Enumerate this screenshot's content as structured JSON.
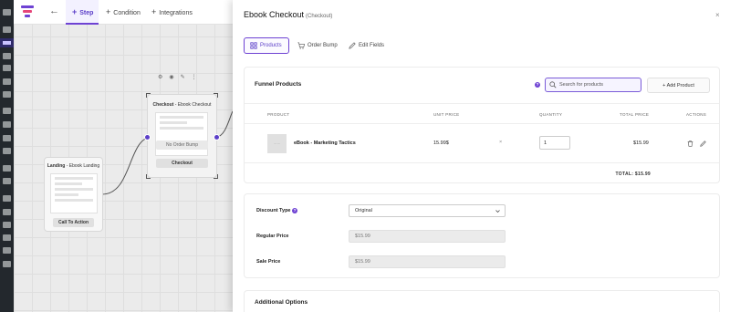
{
  "app": {
    "back_arrow": "←",
    "tabs": [
      {
        "label": "Step",
        "icon": "+"
      },
      {
        "label": "Condition",
        "icon": "+"
      },
      {
        "label": "Integrations",
        "icon": "+"
      }
    ],
    "brand_colors": [
      "#6e42d3",
      "#e6467a",
      "#2f2b6a"
    ]
  },
  "canvas": {
    "landing_node": {
      "title_bold": "Landing",
      "title_rest": " - Ebook Landing",
      "button": "Call To Action"
    },
    "checkout_node": {
      "title_bold": "Checkout",
      "title_rest": " - Ebook Checkout",
      "bump_label": "No Order Bump",
      "button": "Checkout"
    }
  },
  "panel": {
    "title": "Ebook Checkout",
    "subtitle": "(Checkout)",
    "close": "×",
    "tabs": [
      {
        "label": "Products",
        "icon": "grid-icon",
        "active": true
      },
      {
        "label": "Order Bump",
        "icon": "cart-icon",
        "active": false
      },
      {
        "label": "Edit Fields",
        "icon": "pencil-icon",
        "active": false
      }
    ]
  },
  "products": {
    "title": "Funnel Products",
    "help": "?",
    "search_placeholder": "Search for products",
    "add_button": "+ Add Product",
    "columns": [
      "PRODUCT",
      "UNIT PRICE",
      "QUANTITY",
      "TOTAL PRICE",
      "ACTIONS"
    ],
    "rows": [
      {
        "image_text": "— —",
        "name": "eBook - Marketing Tactics",
        "unit_price": "15.99$",
        "multiply": "×",
        "quantity": "1",
        "total_price": "$15.99"
      }
    ],
    "total_label": "TOTAL: $15.99"
  },
  "pricing": {
    "discount_type_label": "Discount Type",
    "help": "?",
    "discount_type_value": "Original",
    "regular_price_label": "Regular Price",
    "regular_price_value": "$15.99",
    "sale_price_label": "Sale Price",
    "sale_price_value": "$15.99"
  },
  "additional": {
    "title": "Additional Options"
  }
}
